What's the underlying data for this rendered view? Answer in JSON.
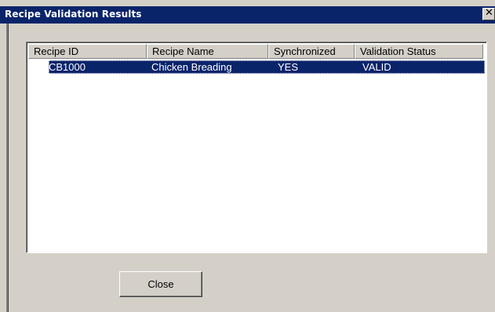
{
  "window": {
    "title": "Recipe Validation Results"
  },
  "list": {
    "columns": [
      "Recipe ID",
      "Recipe Name",
      "Synchronized",
      "Validation Status"
    ],
    "rows": [
      {
        "recipe_id": "CB1000",
        "recipe_name": "Chicken Breading",
        "synchronized": "YES",
        "validation_status": "VALID",
        "selected": true
      }
    ]
  },
  "buttons": {
    "close_label": "Close"
  },
  "colors": {
    "titlebar": "#0a246a",
    "selection": "#0a246a",
    "face": "#d4d0c8"
  }
}
